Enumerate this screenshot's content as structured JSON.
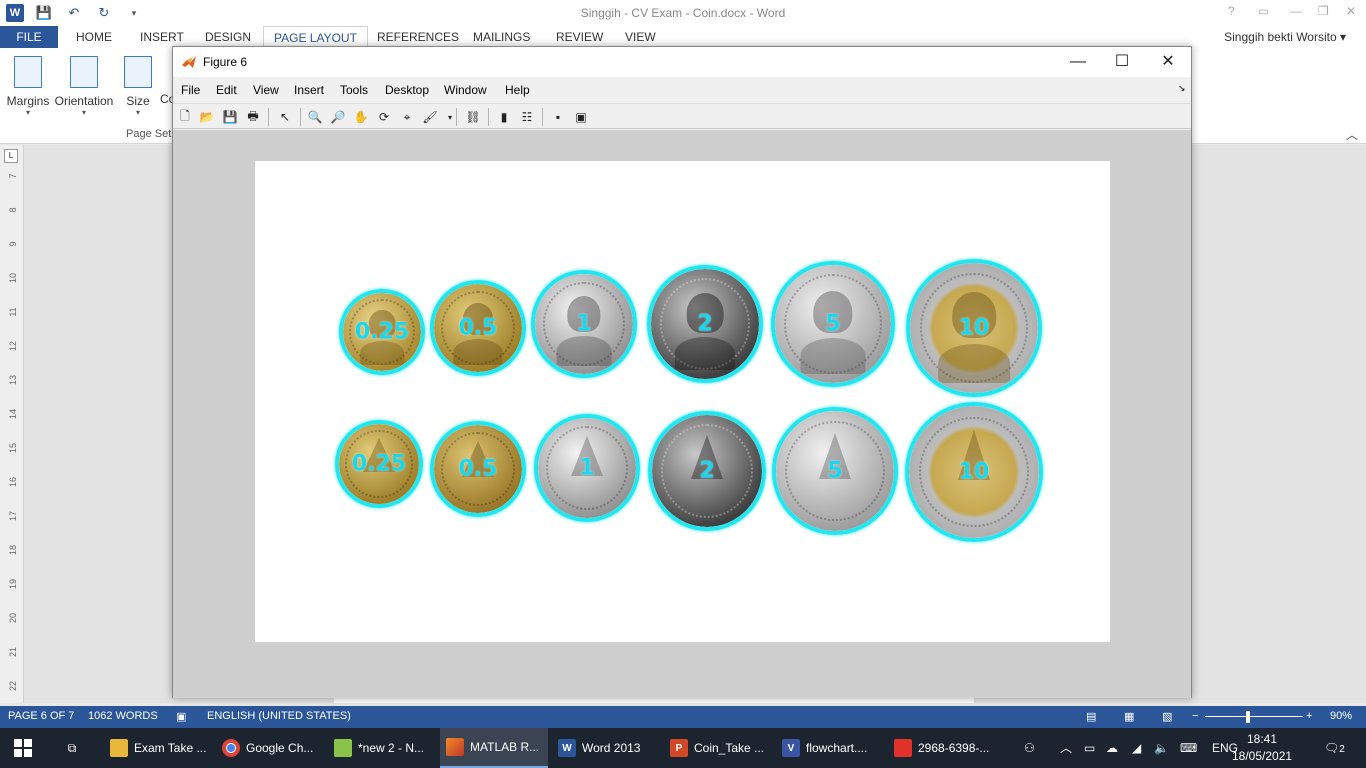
{
  "word": {
    "doc_title": "Singgih - CV Exam - Coin.docx - Word",
    "tabs": [
      "FILE",
      "HOME",
      "INSERT",
      "DESIGN",
      "PAGE LAYOUT",
      "REFERENCES",
      "MAILINGS",
      "REVIEW",
      "VIEW"
    ],
    "active_tab": "PAGE LAYOUT",
    "user": "Singgih bekti Worsito",
    "ribbon_buttons": [
      "Margins",
      "Orientation",
      "Size",
      "Co"
    ],
    "group_label": "Page Setu",
    "ruler_numbers": [
      "7",
      "8",
      "9",
      "10",
      "11",
      "12",
      "13",
      "14",
      "15",
      "16",
      "17",
      "18",
      "19",
      "20",
      "21",
      "22"
    ],
    "status": {
      "page": "PAGE 6 OF 7",
      "words": "1062 WORDS",
      "language": "ENGLISH (UNITED STATES)",
      "zoom": "90%"
    }
  },
  "figure": {
    "title": "Figure 6",
    "menu": [
      "File",
      "Edit",
      "View",
      "Insert",
      "Tools",
      "Desktop",
      "Window",
      "Help"
    ],
    "coins_top": [
      "0.25",
      "0.5",
      "1",
      "2",
      "5",
      "10"
    ],
    "coins_bottom": [
      "0.25",
      "0.5",
      "1",
      "2",
      "5",
      "10"
    ]
  },
  "taskbar": {
    "apps": [
      "Exam Take ...",
      "Google Ch...",
      "*new 2 - N...",
      "MATLAB R...",
      "Word 2013",
      "Coin_Take ...",
      "flowchart....",
      "2968-6398-..."
    ],
    "active_app": "MATLAB R...",
    "language": "ENG",
    "time": "18:41",
    "date": "18/05/2021",
    "notifications": "2"
  }
}
